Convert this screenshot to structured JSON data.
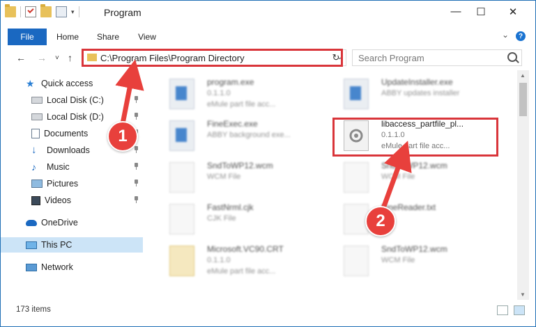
{
  "window": {
    "title": "Program"
  },
  "ribbon": {
    "tabs": [
      "File",
      "Home",
      "Share",
      "View"
    ],
    "help": "?"
  },
  "address": {
    "path": "C:\\Program Files\\Program Directory"
  },
  "search": {
    "placeholder": "Search Program"
  },
  "sidebar": {
    "items": [
      {
        "label": "Quick access",
        "icon": "star-icon"
      },
      {
        "label": "Local Disk (C:)",
        "icon": "drive-icon",
        "pinned": true
      },
      {
        "label": "Local Disk (D:)",
        "icon": "drive-icon",
        "pinned": true
      },
      {
        "label": "Documents",
        "icon": "documents-icon",
        "pinned": true
      },
      {
        "label": "Downloads",
        "icon": "downloads-icon",
        "pinned": true
      },
      {
        "label": "Music",
        "icon": "music-icon",
        "pinned": true
      },
      {
        "label": "Pictures",
        "icon": "pictures-icon",
        "pinned": true
      },
      {
        "label": "Videos",
        "icon": "videos-icon",
        "pinned": true
      },
      {
        "label": "OneDrive",
        "icon": "onedrive-icon"
      },
      {
        "label": "This PC",
        "icon": "pc-icon",
        "selected": true
      },
      {
        "label": "Network",
        "icon": "network-icon"
      }
    ]
  },
  "files": [
    {
      "name": "program.exe",
      "line1": "0.1.1.0",
      "line2": "eMule part file acc..."
    },
    {
      "name": "UpdateInstaller.exe",
      "line1": "ABBY updates installer",
      "line2": ""
    },
    {
      "name": "FineExec.exe",
      "line1": "ABBY background exe...",
      "line2": ""
    },
    {
      "name": "libaccess_partfile_pl...",
      "line1": "0.1.1.0",
      "line2": "eMule part file acc..."
    },
    {
      "name": "SndToWP12.wcm",
      "line1": "WCM File",
      "line2": ""
    },
    {
      "name": "SndToWP12.wcm",
      "line1": "WCM File",
      "line2": ""
    },
    {
      "name": "FastNrml.cjk",
      "line1": "CJK File",
      "line2": ""
    },
    {
      "name": "FineReader.txt",
      "line1": "",
      "line2": ""
    },
    {
      "name": "Microsoft.VC90.CRT",
      "line1": "0.1.1.0",
      "line2": "eMule part file acc..."
    },
    {
      "name": "SndToWP12.wcm",
      "line1": "WCM File",
      "line2": ""
    }
  ],
  "status": {
    "count": "173 items"
  },
  "callouts": {
    "one": "1",
    "two": "2"
  },
  "colors": {
    "accent": "#1a68c1",
    "highlight": "#d9353a",
    "selected": "#cce4f7"
  }
}
